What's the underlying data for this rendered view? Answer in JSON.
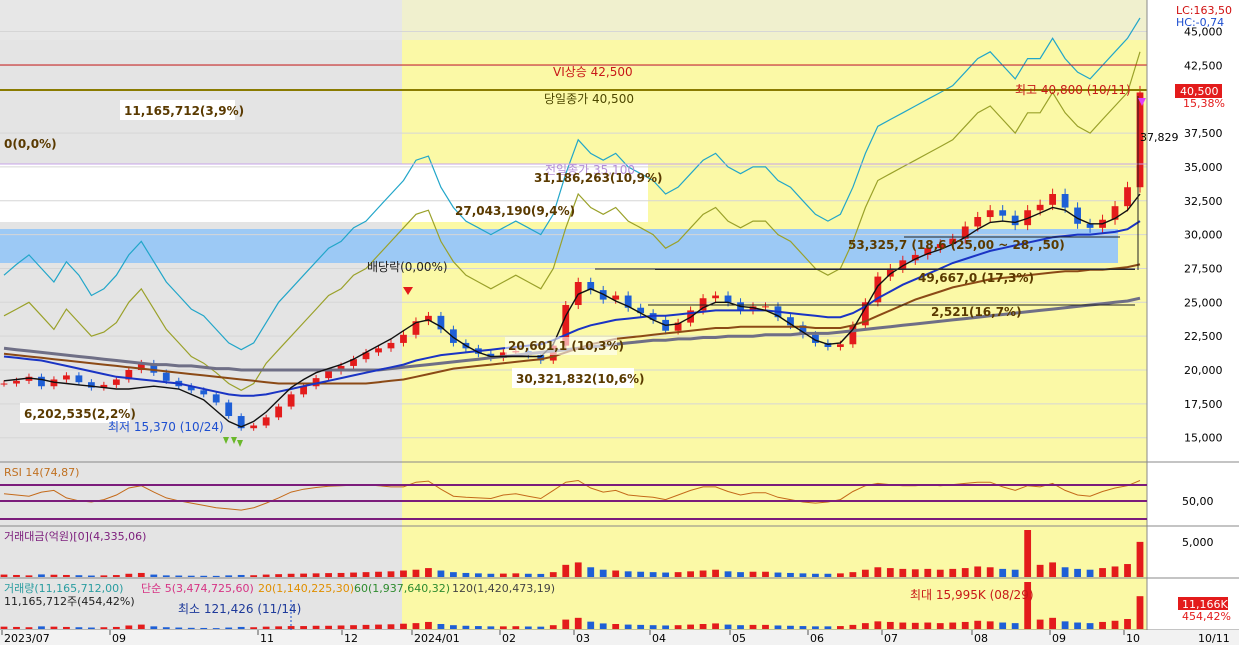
{
  "chart_data": {
    "type": "candlestick",
    "x_axis": {
      "labels": [
        "2023/07",
        "09",
        "11",
        "12",
        "2024/01",
        "02",
        "03",
        "04",
        "05",
        "06",
        "07",
        "08",
        "09",
        "10",
        "10/11"
      ]
    },
    "price_axis": {
      "ticks": [
        "45,000",
        "42,500",
        "40,500",
        "37,500",
        "35,000",
        "32,500",
        "30,000",
        "27,500",
        "25,000",
        "22,500",
        "20,000",
        "17,500",
        "15,000"
      ],
      "top_labels": [
        "LC:163,50",
        "HC:-0,74"
      ],
      "current_price": "40,500",
      "current_change": "15,38%",
      "extra_label": "37,829",
      "ylim": [
        13500,
        46000
      ]
    },
    "price_annotations": [
      "VI상승 42,500",
      "당일종가 40,500",
      "최고 40,800 (10/11)",
      "11,165,712(3,9%)",
      "0(0,0%)",
      "전일종가 35,100",
      "31,186,263(10,9%)",
      "27,043,190(9,4%)",
      "배당락(0,00%)",
      "53,325,7 (18,6 (25,00 ~ 28, ,50)",
      "49,667,0 (17,3%)",
      "2,521(16,7%)",
      "20,601,1 (10,3%)",
      "30,321,832(10,6%)",
      "6,202,535(2,2%)",
      "최저 15,370 (10/24)"
    ],
    "price_series": {
      "closes": [
        19000,
        19200,
        19500,
        18800,
        19300,
        19600,
        19100,
        18700,
        18900,
        19300,
        20000,
        20500,
        19800,
        19200,
        18800,
        18500,
        18200,
        17600,
        16600,
        15700,
        15900,
        16500,
        17300,
        18200,
        18800,
        19400,
        19900,
        20300,
        20800,
        21300,
        21600,
        22000,
        22600,
        23600,
        24000,
        23000,
        22000,
        21600,
        21200,
        20900,
        21300,
        21400,
        21100,
        20700,
        21800,
        24800,
        26500,
        25900,
        25200,
        25500,
        24600,
        24200,
        23700,
        22900,
        23500,
        24400,
        25300,
        25500,
        25000,
        24400,
        24700,
        24700,
        23900,
        23300,
        22600,
        22000,
        21700,
        21900,
        23300,
        25000,
        26900,
        27500,
        28100,
        28500,
        29000,
        29300,
        29700,
        30600,
        31300,
        31800,
        31400,
        30700,
        31800,
        32200,
        33000,
        32000,
        30800,
        30500,
        31100,
        32100,
        33500,
        40500
      ],
      "ma_black": [
        19200,
        19300,
        19400,
        19300,
        19100,
        19000,
        18900,
        18800,
        18700,
        18600,
        18600,
        18700,
        18800,
        18700,
        18600,
        18200,
        17800,
        17000,
        16200,
        15800,
        16200,
        16900,
        17800,
        18700,
        19300,
        19800,
        20100,
        20400,
        20800,
        21300,
        21800,
        22300,
        22900,
        23500,
        23700,
        23200,
        22400,
        21800,
        21300,
        21000,
        21000,
        21000,
        21000,
        21000,
        21900,
        24000,
        25600,
        26000,
        25600,
        25100,
        24700,
        24200,
        23700,
        23300,
        23400,
        23900,
        24600,
        25000,
        25000,
        24700,
        24600,
        24400,
        24000,
        23400,
        22800,
        22200,
        21900,
        22000,
        23000,
        24600,
        26200,
        27100,
        27700,
        28200,
        28600,
        28900,
        29300,
        29800,
        30400,
        30900,
        31000,
        30900,
        31200,
        31600,
        32000,
        31800,
        31200,
        30800,
        30800,
        31200,
        31800,
        33000
      ],
      "ma_blue": [
        21000,
        20900,
        20800,
        20700,
        20500,
        20300,
        20100,
        19900,
        19700,
        19500,
        19400,
        19300,
        19200,
        19100,
        19000,
        18800,
        18600,
        18400,
        18200,
        18100,
        18100,
        18200,
        18400,
        18600,
        18800,
        19000,
        19200,
        19400,
        19600,
        19800,
        20000,
        20200,
        20400,
        20700,
        20900,
        21100,
        21200,
        21300,
        21400,
        21500,
        21600,
        21700,
        21800,
        21900,
        22200,
        22600,
        23000,
        23300,
        23500,
        23700,
        23800,
        23900,
        24000,
        24000,
        24100,
        24200,
        24300,
        24400,
        24400,
        24400,
        24400,
        24400,
        24300,
        24200,
        24100,
        24000,
        23900,
        23900,
        24200,
        24700,
        25300,
        25800,
        26300,
        26700,
        27100,
        27500,
        27900,
        28200,
        28500,
        28800,
        29000,
        29200,
        29400,
        29600,
        29800,
        29900,
        30000,
        30000,
        30100,
        30200,
        30400,
        31000
      ],
      "ma_gray": [
        21600,
        21500,
        21400,
        21300,
        21200,
        21100,
        21000,
        20900,
        20800,
        20700,
        20600,
        20500,
        20400,
        20400,
        20300,
        20300,
        20200,
        20100,
        20100,
        20000,
        20000,
        20000,
        20000,
        20000,
        20000,
        20000,
        20000,
        20000,
        20000,
        20000,
        20000,
        20100,
        20200,
        20300,
        20400,
        20500,
        20600,
        20700,
        20800,
        20900,
        21000,
        21100,
        21200,
        21300,
        21400,
        21500,
        21600,
        21700,
        21800,
        21900,
        22000,
        22100,
        22200,
        22200,
        22300,
        22300,
        22400,
        22400,
        22500,
        22500,
        22500,
        22600,
        22600,
        22600,
        22700,
        22700,
        22700,
        22800,
        22900,
        23000,
        23100,
        23200,
        23300,
        23400,
        23500,
        23600,
        23700,
        23800,
        23900,
        24000,
        24100,
        24200,
        24300,
        24400,
        24500,
        24600,
        24700,
        24800,
        24900,
        25000,
        25100,
        25300
      ],
      "ma_brown": [
        21200,
        21100,
        21000,
        20900,
        20800,
        20700,
        20600,
        20500,
        20400,
        20300,
        20200,
        20100,
        20000,
        19900,
        19800,
        19700,
        19600,
        19500,
        19400,
        19300,
        19200,
        19100,
        19000,
        19000,
        19000,
        19000,
        19000,
        19000,
        19000,
        19000,
        19100,
        19200,
        19300,
        19500,
        19700,
        19900,
        20100,
        20200,
        20300,
        20400,
        20500,
        20600,
        20700,
        20800,
        21000,
        21300,
        21600,
        21900,
        22100,
        22300,
        22400,
        22500,
        22600,
        22700,
        22800,
        22900,
        23000,
        23100,
        23100,
        23200,
        23200,
        23200,
        23200,
        23200,
        23200,
        23100,
        23100,
        23100,
        23300,
        23600,
        24000,
        24400,
        24800,
        25200,
        25500,
        25800,
        26100,
        26300,
        26500,
        26700,
        26800,
        26900,
        27000,
        27100,
        27200,
        27300,
        27300,
        27400,
        27400,
        27500,
        27600,
        27800
      ],
      "band_upper": [
        27000,
        27800,
        28500,
        27500,
        26500,
        28000,
        27000,
        25500,
        26000,
        27000,
        28500,
        29500,
        28000,
        26500,
        25500,
        24500,
        24000,
        23000,
        22000,
        21500,
        22000,
        23500,
        25000,
        26000,
        27000,
        28000,
        29000,
        29500,
        30500,
        31000,
        32000,
        33000,
        34000,
        35500,
        35800,
        33500,
        32000,
        31000,
        30500,
        30000,
        30500,
        31000,
        30500,
        30000,
        31500,
        34500,
        37000,
        36000,
        35500,
        36000,
        35000,
        34500,
        34000,
        33000,
        33500,
        34500,
        35500,
        36000,
        35000,
        34500,
        35000,
        35000,
        34000,
        33500,
        32500,
        31500,
        31000,
        31500,
        33500,
        36000,
        38000,
        38500,
        39000,
        39500,
        40000,
        40500,
        41000,
        42000,
        43000,
        43500,
        42500,
        41500,
        43000,
        43000,
        44500,
        43000,
        42000,
        41500,
        42500,
        43500,
        44500,
        46000
      ],
      "band_lower": [
        24000,
        24500,
        25000,
        24000,
        23000,
        24500,
        23500,
        22500,
        22800,
        23500,
        25000,
        26000,
        24500,
        23000,
        22000,
        21000,
        20500,
        19800,
        19000,
        18500,
        19000,
        20500,
        21500,
        22500,
        23500,
        24500,
        25500,
        26000,
        27000,
        27500,
        28500,
        29500,
        30500,
        31500,
        31800,
        29500,
        28000,
        27000,
        26500,
        26000,
        26500,
        27000,
        26500,
        26000,
        27500,
        30500,
        33000,
        32000,
        31500,
        32000,
        31000,
        30500,
        30000,
        29000,
        29500,
        30500,
        31500,
        32000,
        31000,
        30500,
        31000,
        31000,
        30000,
        29500,
        28500,
        27500,
        27000,
        27500,
        29500,
        32000,
        34000,
        34500,
        35000,
        35500,
        36000,
        36500,
        37000,
        38000,
        39000,
        39500,
        38500,
        37500,
        39000,
        39000,
        40500,
        39000,
        38000,
        37500,
        38500,
        39500,
        40500,
        43500
      ]
    },
    "rsi_panel": {
      "label": "RSI 14(74,87)",
      "tick": "50,00",
      "values": [
        52,
        50,
        48,
        55,
        58,
        45,
        40,
        38,
        42,
        50,
        62,
        66,
        55,
        45,
        40,
        36,
        32,
        28,
        26,
        24,
        28,
        36,
        45,
        55,
        60,
        63,
        65,
        66,
        67,
        68,
        66,
        64,
        64,
        72,
        74,
        60,
        48,
        46,
        45,
        44,
        50,
        52,
        48,
        44,
        58,
        72,
        75,
        62,
        55,
        58,
        50,
        48,
        46,
        42,
        50,
        58,
        64,
        64,
        56,
        50,
        54,
        54,
        46,
        42,
        38,
        36,
        38,
        42,
        56,
        66,
        70,
        68,
        66,
        66,
        68,
        66,
        68,
        70,
        72,
        72,
        64,
        58,
        66,
        64,
        70,
        58,
        50,
        48,
        56,
        62,
        66,
        75
      ]
    },
    "amount_panel": {
      "label": "거래대금(억원)[0](4,335,06)",
      "tick": "5,000",
      "values": [
        300,
        250,
        200,
        320,
        280,
        250,
        220,
        180,
        200,
        240,
        400,
        500,
        300,
        200,
        180,
        160,
        150,
        140,
        200,
        250,
        220,
        300,
        350,
        400,
        420,
        450,
        480,
        500,
        550,
        600,
        650,
        700,
        800,
        900,
        1100,
        800,
        600,
        500,
        450,
        400,
        420,
        450,
        400,
        380,
        600,
        1500,
        1800,
        1200,
        900,
        800,
        700,
        650,
        600,
        550,
        600,
        700,
        800,
        900,
        700,
        600,
        650,
        650,
        550,
        500,
        450,
        400,
        400,
        450,
        600,
        900,
        1200,
        1100,
        1000,
        950,
        1000,
        900,
        1000,
        1100,
        1300,
        1200,
        1000,
        900,
        5800,
        1500,
        1800,
        1200,
        1000,
        900,
        1100,
        1300,
        1600,
        4335
      ]
    },
    "volume_panel": {
      "legend": [
        "거래량(11,165,712,00)",
        "단순 5(3,474,725,60)",
        "20(1,140,225,30)",
        "60(1,937,640,32)",
        "120(1,420,473,19)"
      ],
      "sub_label": "11,165,712주(454,42%)",
      "min_label": "최소 121,426 (11/14)",
      "max_label": "최대 15,995K (08/29)",
      "right_labels": [
        "11,166K",
        "454,42%"
      ],
      "values": [
        800,
        700,
        600,
        900,
        800,
        700,
        600,
        500,
        600,
        700,
        1200,
        1500,
        900,
        600,
        500,
        400,
        350,
        300,
        500,
        700,
        600,
        800,
        900,
        1000,
        1000,
        1100,
        1100,
        1200,
        1300,
        1400,
        1500,
        1600,
        1800,
        2000,
        2400,
        1700,
        1300,
        1100,
        1000,
        900,
        900,
        950,
        850,
        800,
        1300,
        3200,
        3800,
        2500,
        1900,
        1700,
        1500,
        1400,
        1300,
        1200,
        1300,
        1500,
        1700,
        1900,
        1500,
        1300,
        1400,
        1400,
        1200,
        1100,
        1000,
        900,
        900,
        1000,
        1400,
        2000,
        2600,
        2400,
        2200,
        2100,
        2200,
        2000,
        2200,
        2400,
        2800,
        2600,
        2200,
        2000,
        15995,
        3200,
        3800,
        2600,
        2200,
        2000,
        2400,
        2800,
        3400,
        11166
      ]
    }
  }
}
